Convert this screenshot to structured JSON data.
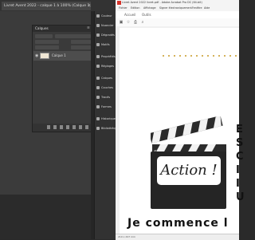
{
  "photoshop": {
    "doc_tab": "Livret Avent 2022 - calque 1 à 100% (Calque 1, RVB/8) *",
    "layers_panel": {
      "title": "Calques",
      "layer_name": "Calque 1"
    },
    "panels": [
      "Couleur",
      "Nuancier",
      "Dégradés",
      "Motifs",
      "Propriétés",
      "Réglages",
      "Calques",
      "Couches",
      "Tracés",
      "Formes",
      "Historique",
      "Bibliothèques"
    ]
  },
  "acrobat": {
    "title": "Livret Avent 2022 livret.pdf - Adobe Acrobat Pro DC (64-bit)",
    "menu": [
      "Fichier",
      "Edition",
      "Affichage",
      "Signer électroniquement",
      "Fenêtre",
      "Aide"
    ],
    "tabs": [
      "Accueil",
      "Outils"
    ],
    "action_label": "Action !",
    "bottom_text": "Je commence l",
    "side_letters": [
      "E",
      "S",
      "C",
      "I",
      "I",
      "U"
    ],
    "status": "210 x 297 mm"
  }
}
